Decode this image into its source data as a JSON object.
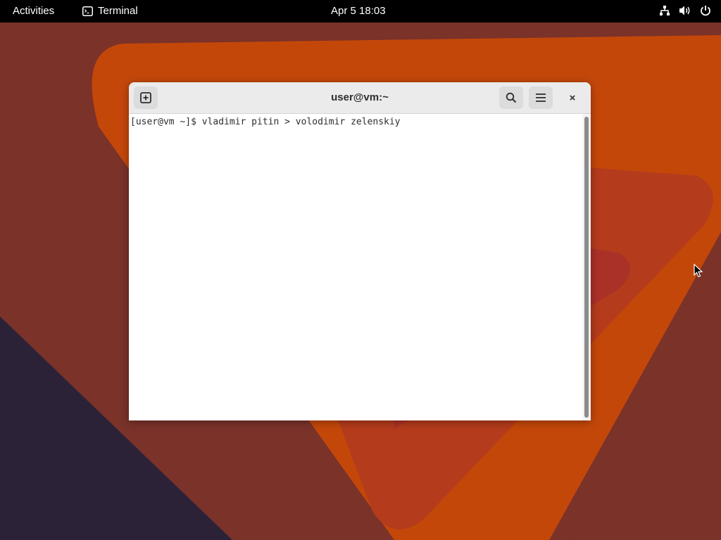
{
  "topbar": {
    "activities": "Activities",
    "app_name": "Terminal",
    "app_icon": "terminal-icon",
    "clock": "Apr 5  18:03",
    "status_icons": [
      "network-icon",
      "volume-icon",
      "power-icon"
    ]
  },
  "window": {
    "title": "user@vm:~",
    "buttons": [
      "new-tab-icon",
      "search-icon",
      "hamburger-menu-icon",
      "close-icon"
    ],
    "close_glyph": "×"
  },
  "terminal": {
    "line": "[user@vm ~]$ vladimir pitin > volodimir zelenskiy"
  },
  "colors": {
    "wallpaper_base": "#7a3229",
    "wallpaper_orange": "#c4470a",
    "wallpaper_red": "#a83326",
    "wallpaper_dark": "#2b2238",
    "topbar": "#000000",
    "headerbar": "#ebebeb"
  }
}
